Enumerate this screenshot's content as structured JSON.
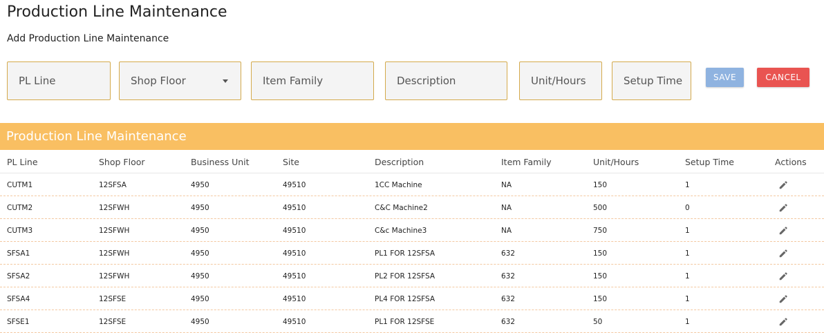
{
  "page": {
    "title": "Production Line Maintenance",
    "subtitle": "Add Production Line Maintenance"
  },
  "form": {
    "pl_line": {
      "placeholder": "PL Line",
      "value": ""
    },
    "shop_floor": {
      "placeholder": "Shop Floor",
      "value": ""
    },
    "item_family": {
      "placeholder": "Item Family",
      "value": ""
    },
    "description": {
      "placeholder": "Description",
      "value": ""
    },
    "unit_hours": {
      "placeholder": "Unit/Hours",
      "value": ""
    },
    "setup_time": {
      "placeholder": "Setup Time",
      "value": ""
    },
    "save_label": "SAVE",
    "cancel_label": "CANCEL"
  },
  "table": {
    "title": "Production Line Maintenance",
    "columns": [
      "PL Line",
      "Shop Floor",
      "Business Unit",
      "Site",
      "Description",
      "Item Family",
      "Unit/Hours",
      "Setup Time",
      "Actions"
    ],
    "rows": [
      [
        "CUTM1",
        "12SFSA",
        "4950",
        "49510",
        "1CC Machine",
        "NA",
        "150",
        "1"
      ],
      [
        "CUTM2",
        "12SFWH",
        "4950",
        "49510",
        "C&C Machine2",
        "NA",
        "500",
        "0"
      ],
      [
        "CUTM3",
        "12SFWH",
        "4950",
        "49510",
        "C&c Machine3",
        "NA",
        "750",
        "1"
      ],
      [
        "SFSA1",
        "12SFWH",
        "4950",
        "49510",
        "PL1 FOR 12SFSA",
        "632",
        "150",
        "1"
      ],
      [
        "SFSA2",
        "12SFWH",
        "4950",
        "49510",
        "PL2 FOR 12SFSA",
        "632",
        "150",
        "1"
      ],
      [
        "SFSA4",
        "12SFSE",
        "4950",
        "49510",
        "PL4 FOR 12SFSA",
        "632",
        "150",
        "1"
      ],
      [
        "SFSE1",
        "12SFSE",
        "4950",
        "49510",
        "PL1 FOR 12SFSE",
        "632",
        "50",
        "1"
      ]
    ],
    "row_action_icon": "pencil-icon"
  },
  "colors": {
    "accent": "#f9bf62",
    "field_border": "#d4a94a",
    "save": "#8fb3e0",
    "cancel": "#e95451"
  }
}
